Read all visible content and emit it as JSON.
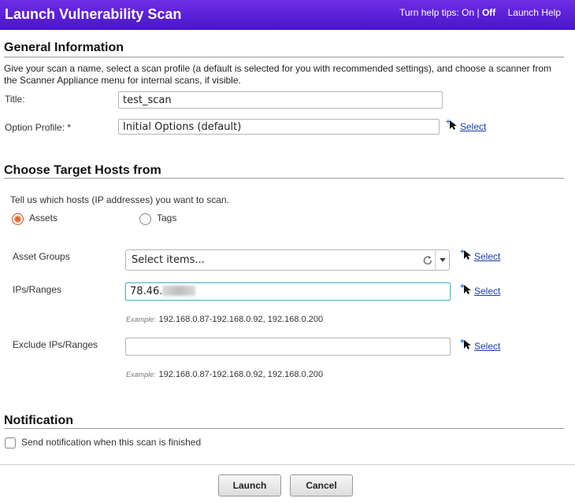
{
  "header": {
    "title": "Launch Vulnerability Scan",
    "help_prefix": "Turn help tips:",
    "help_on": "On",
    "help_sep": "|",
    "help_off": "Off",
    "launch_help": "Launch Help"
  },
  "general": {
    "heading": "General Information",
    "description": "Give your scan a name, select a scan profile (a default is selected for you with recommended settings), and choose a scanner from the Scanner Appliance menu for internal scans, if visible.",
    "title_label": "Title:",
    "title_value": "test_scan",
    "profile_label": "Option Profile: *",
    "profile_value": "Initial Options (default)",
    "select_label": "Select"
  },
  "targets": {
    "heading": "Choose Target Hosts from",
    "instruction": "Tell us which hosts (IP addresses) you want to scan.",
    "radio_assets": "Assets",
    "radio_tags": "Tags",
    "asset_groups_label": "Asset Groups",
    "asset_groups_placeholder": "Select items...",
    "ips_label": "IPs/Ranges",
    "ips_value": "78.46.",
    "exclude_label": "Exclude IPs/Ranges",
    "exclude_value": "",
    "example_label": "Example:",
    "example_value": "192.168.0.87-192.168.0.92, 192.168.0.200",
    "select_label": "Select"
  },
  "notification": {
    "heading": "Notification",
    "checkbox_label": "Send notification when this scan is finished"
  },
  "footer": {
    "launch_label": "Launch",
    "cancel_label": "Cancel"
  }
}
